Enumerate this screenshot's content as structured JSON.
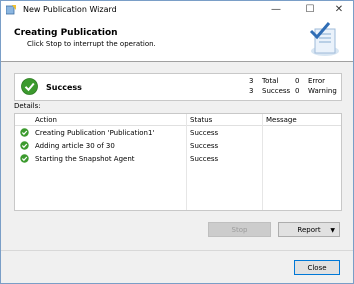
{
  "window": {
    "title": "New Publication Wizard",
    "minimize": "—",
    "maximize": "☐",
    "close": "✕"
  },
  "header": {
    "title": "Creating Publication",
    "subtitle": "Click Stop to interrupt the operation."
  },
  "status": {
    "text": "Success",
    "total_count": "3",
    "total_label": "Total",
    "success_count": "3",
    "success_label": "Success",
    "error_count": "0",
    "error_label": "Error",
    "warning_count": "0",
    "warning_label": "Warning"
  },
  "details": {
    "label": "Details:",
    "columns": [
      "Action",
      "Status",
      "Message"
    ],
    "rows": [
      {
        "action": "Creating Publication 'Publication1'",
        "status": "Success",
        "message": ""
      },
      {
        "action": "Adding article 30 of 30",
        "status": "Success",
        "message": ""
      },
      {
        "action": "Starting the Snapshot Agent",
        "status": "Success",
        "message": ""
      }
    ]
  },
  "buttons": {
    "stop": "Stop",
    "report": "Report",
    "report_arrow": "▼",
    "close": "Close"
  },
  "colors": {
    "success_green": "#3c9a2e",
    "accent": "#0078d7"
  }
}
